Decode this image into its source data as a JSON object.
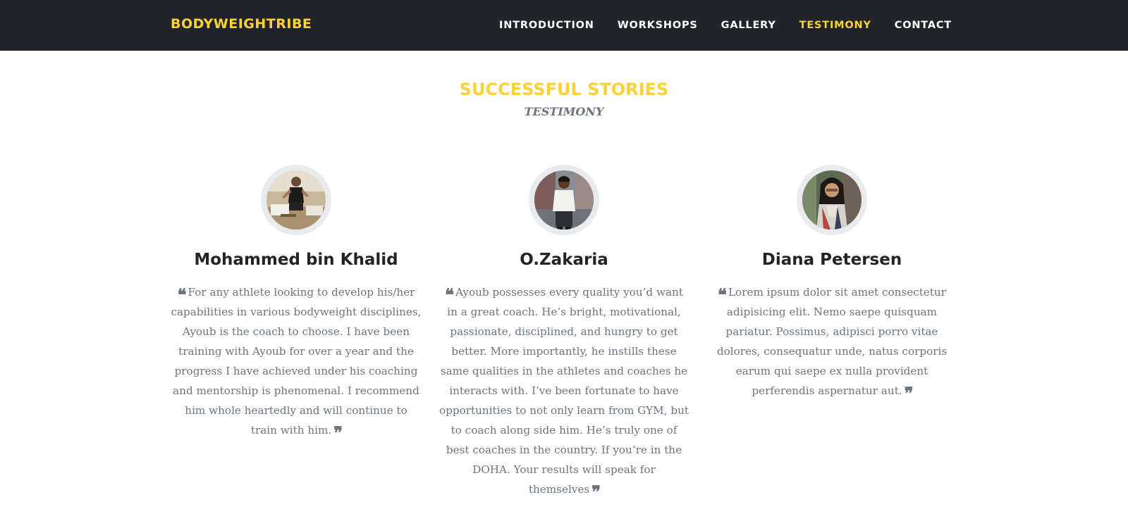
{
  "nav": {
    "brand": "BODYWEIGHTRIBE",
    "items": [
      "INTRODUCTION",
      "WORKSHOPS",
      "GALLERY",
      "TESTIMONY",
      "CONTACT"
    ],
    "active": "TESTIMONY"
  },
  "section": {
    "heading": "SUCCESSFUL STORIES",
    "subheading": "TESTIMONY"
  },
  "testimonials": [
    {
      "name": "Mohammed bin Khalid",
      "quote": "For any athlete looking to develop his/her capabilities in various bodyweight disciplines, Ayoub is the coach to choose. I have been training with Ayoub for over a year and the progress I have achieved under his coaching and mentorship is phenomenal. I recommend him whole heartedly and will continue to train with him."
    },
    {
      "name": "O.Zakaria",
      "quote": "Ayoub possesses every quality you’d want in a great coach. He’s bright, motivational, passionate, disciplined, and hungry to get better. More importantly, he instills these same qualities in the athletes and coaches he interacts with. I’ve been fortunate to have opportunities to not only learn from GYM, but to coach along side him. He’s truly one of best coaches in the country. If you’re in the DOHA. Your results will speak for themselves"
    },
    {
      "name": "Diana Petersen",
      "quote": "Lorem ipsum dolor sit amet consectetur adipisicing elit. Nemo saepe quisquam pariatur. Possimus, adipisci porro vitae dolores, consequatur unde, natus corporis earum qui saepe ex nulla provident perferendis aspernatur aut."
    }
  ],
  "colors": {
    "navbar_bg": "#212529",
    "accent": "#fed136",
    "text_muted": "#6c757d",
    "heading": "#212529",
    "avatar_ring": "#e9ecef"
  },
  "icons": {
    "quote_open": "quote-left-icon",
    "quote_close": "quote-right-icon"
  }
}
